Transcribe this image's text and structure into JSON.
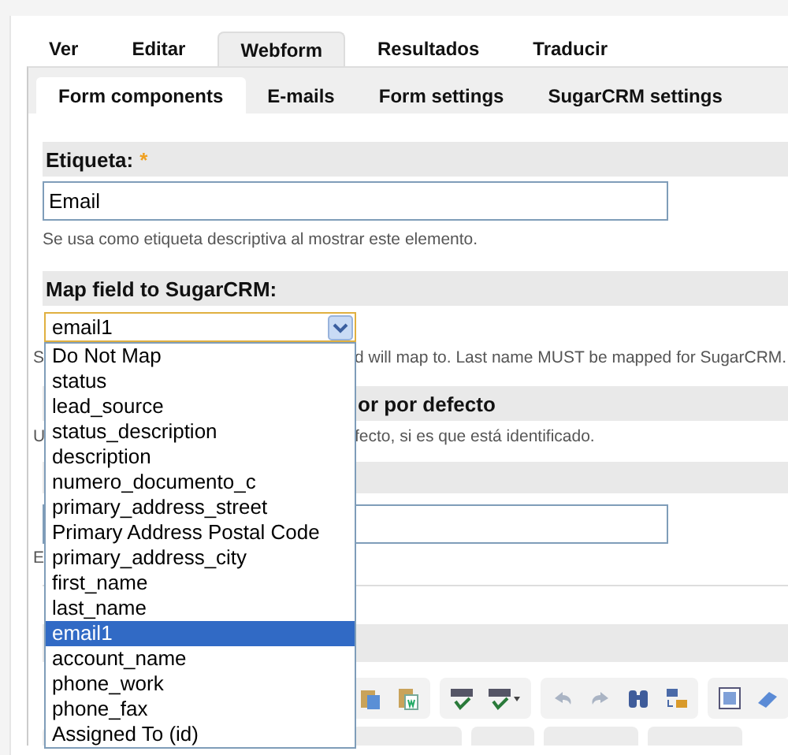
{
  "top_tabs": [
    {
      "label": "Ver",
      "selected": false
    },
    {
      "label": "Editar",
      "selected": false
    },
    {
      "label": "Webform",
      "selected": true
    },
    {
      "label": "Resultados",
      "selected": false
    },
    {
      "label": "Traducir",
      "selected": false
    }
  ],
  "sub_tabs": [
    {
      "label": "Form components",
      "selected": true
    },
    {
      "label": "E-mails",
      "selected": false
    },
    {
      "label": "Form settings",
      "selected": false
    },
    {
      "label": "SugarCRM settings",
      "selected": false
    }
  ],
  "label_field": {
    "heading": "Etiqueta:",
    "required_mark": "*",
    "value": "Email",
    "help": "Se usa como etiqueta descriptiva al mostrar este elemento."
  },
  "map_field": {
    "heading": "Map field to SugarCRM:",
    "value": "email1",
    "expanded": true,
    "help_left": "S",
    "help_right": "d will map to. Last name MUST be mapped for SugarCRM.",
    "options": [
      {
        "label": "Do Not Map",
        "selected": false
      },
      {
        "label": "status",
        "selected": false
      },
      {
        "label": "lead_source",
        "selected": false
      },
      {
        "label": "status_description",
        "selected": false
      },
      {
        "label": "description",
        "selected": false
      },
      {
        "label": "numero_documento_c",
        "selected": false
      },
      {
        "label": "primary_address_street",
        "selected": false
      },
      {
        "label": "Primary Address Postal Code",
        "selected": false
      },
      {
        "label": "primary_address_city",
        "selected": false
      },
      {
        "label": "first_name",
        "selected": false
      },
      {
        "label": "last_name",
        "selected": false
      },
      {
        "label": "email1",
        "selected": true
      },
      {
        "label": "account_name",
        "selected": false
      },
      {
        "label": "phone_work",
        "selected": false
      },
      {
        "label": "phone_fax",
        "selected": false
      },
      {
        "label": "Assigned To (id)",
        "selected": false
      }
    ]
  },
  "default_field": {
    "heading_part": "or por defecto",
    "help_left": "U",
    "help_right": "fecto, si es que está identificado."
  },
  "description_field": {
    "help_left": "E"
  }
}
